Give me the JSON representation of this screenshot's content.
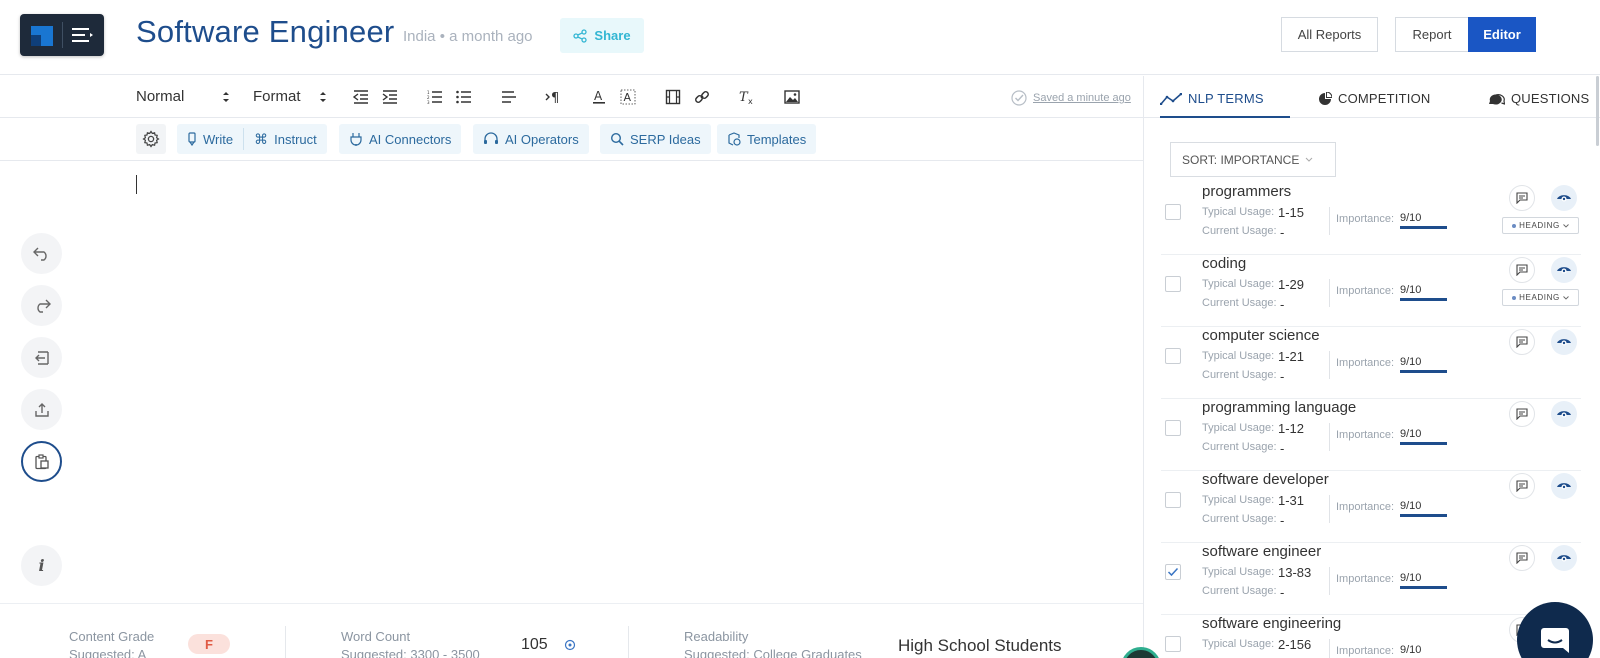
{
  "header": {
    "title": "Software Engineer",
    "location": "India",
    "time": "a month ago",
    "share_label": "Share",
    "all_reports_label": "All Reports",
    "report_label": "Report",
    "editor_label": "Editor"
  },
  "toolbar": {
    "style_select": "Normal",
    "format_select": "Format",
    "saved_text": "Saved a minute ago"
  },
  "ai_toolbar": {
    "write": "Write",
    "instruct": "Instruct",
    "connectors": "AI Connectors",
    "operators": "AI Operators",
    "serp": "SERP Ideas",
    "templates": "Templates"
  },
  "bottom": {
    "content_grade_label": "Content Grade",
    "content_grade_suggested": "Suggested: A",
    "content_grade_value": "F",
    "word_count_label": "Word Count",
    "word_count_suggested": "Suggested: 3300 - 3500",
    "word_count_value": "105",
    "readability_label": "Readability",
    "readability_suggested": "Suggested: College Graduates",
    "readability_value": "High School Students"
  },
  "panel": {
    "tabs": [
      "NLP TERMS",
      "COMPETITION",
      "QUESTIONS"
    ],
    "sort_label": "SORT: IMPORTANCE",
    "typical_label": "Typical Usage:",
    "current_label": "Current Usage:",
    "importance_label": "Importance:",
    "heading_tag": "HEADING",
    "terms": [
      {
        "name": "programmers",
        "typical": "1-15",
        "current": "-",
        "importance": "9/10",
        "checked": false,
        "heading": true
      },
      {
        "name": "coding",
        "typical": "1-29",
        "current": "-",
        "importance": "9/10",
        "checked": false,
        "heading": true
      },
      {
        "name": "computer science",
        "typical": "1-21",
        "current": "-",
        "importance": "9/10",
        "checked": false,
        "heading": false
      },
      {
        "name": "programming language",
        "typical": "1-12",
        "current": "-",
        "importance": "9/10",
        "checked": false,
        "heading": false
      },
      {
        "name": "software developer",
        "typical": "1-31",
        "current": "-",
        "importance": "9/10",
        "checked": false,
        "heading": false
      },
      {
        "name": "software engineer",
        "typical": "13-83",
        "current": "-",
        "importance": "9/10",
        "checked": true,
        "heading": false
      },
      {
        "name": "software engineering",
        "typical": "2-156",
        "current": "-",
        "importance": "9/10",
        "checked": false,
        "heading": false
      }
    ]
  },
  "colors": {
    "brand_blue": "#1e4d8c",
    "editor_button": "#1a56c4",
    "share_accent": "#32b6d3",
    "grade_red": "#e05a44"
  },
  "icons": {
    "menu": "menu-icon",
    "share": "share-icon",
    "undo": "undo-icon",
    "redo": "redo-icon",
    "import": "import-icon",
    "export": "export-icon",
    "clipboard": "clipboard-icon",
    "info": "info-icon",
    "chat": "chat-icon"
  }
}
